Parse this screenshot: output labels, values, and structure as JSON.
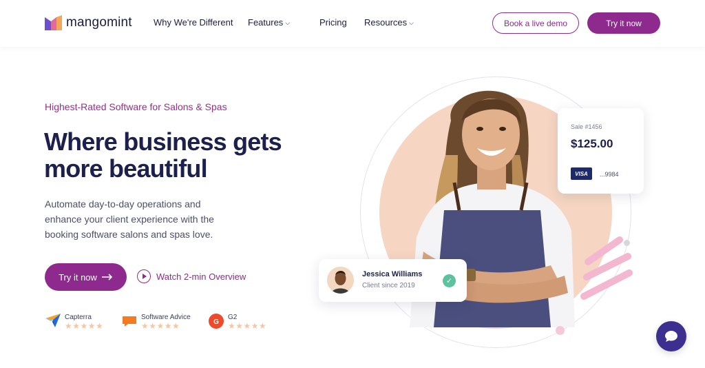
{
  "nav": {
    "logo_text": "mangomint",
    "links": [
      {
        "label": "Why We're Different",
        "has_dropdown": false
      },
      {
        "label": "Features",
        "has_dropdown": true
      },
      {
        "label": "Pricing",
        "has_dropdown": false
      },
      {
        "label": "Resources",
        "has_dropdown": true
      }
    ],
    "demo_button": "Book a live demo",
    "try_button": "Try it now"
  },
  "hero": {
    "eyebrow": "Highest-Rated Software for Salons & Spas",
    "headline_line1": "Where business gets",
    "headline_line2": "more beautiful",
    "subcopy": "Automate day-to-day operations and enhance your client experience with the booking software salons and spas love.",
    "try_button": "Try it now",
    "watch_link": "Watch 2-min Overview"
  },
  "reviews": [
    {
      "name": "Capterra",
      "icon": "capterra-icon",
      "stars": 5
    },
    {
      "name": "Software Advice",
      "icon": "software-advice-icon",
      "stars": 5
    },
    {
      "name": "G2",
      "icon": "g2-icon",
      "stars": 5
    }
  ],
  "sale_card": {
    "label": "Sale #1456",
    "amount": "$125.00",
    "card_brand": "VISA",
    "card_last": "...9984"
  },
  "client_card": {
    "name": "Jessica Williams",
    "since": "Client since 2019"
  },
  "colors": {
    "brand_purple": "#8e2a8e",
    "navy": "#1d1f4c",
    "peach": "#f6d6c2",
    "star": "#f3c6a6",
    "check_green": "#5cc29e",
    "chat_bg": "#3d2f8f"
  }
}
